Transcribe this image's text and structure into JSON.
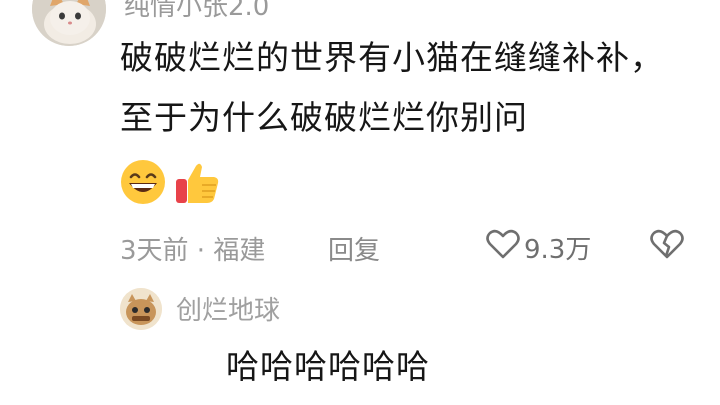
{
  "comment": {
    "username": "纯情小张2.0",
    "text": "破破烂烂的世界有小猫在缝缝补补，至于为什么破破烂烂你别问",
    "emojis": [
      "grinning-face-emoji",
      "thumbs-up-emoji"
    ],
    "time": "3天前",
    "separator": " · ",
    "location": "福建",
    "reply_label": "回复",
    "like_count": "9.3万"
  },
  "reply": {
    "username": "创烂地球",
    "text": "哈哈哈哈哈哈"
  },
  "colors": {
    "text_primary": "#161616",
    "text_muted": "#9a9a9a",
    "icon": "#6f6f6f",
    "emoji_yellow": "#ffc83d",
    "emoji_red": "#e8424a"
  }
}
